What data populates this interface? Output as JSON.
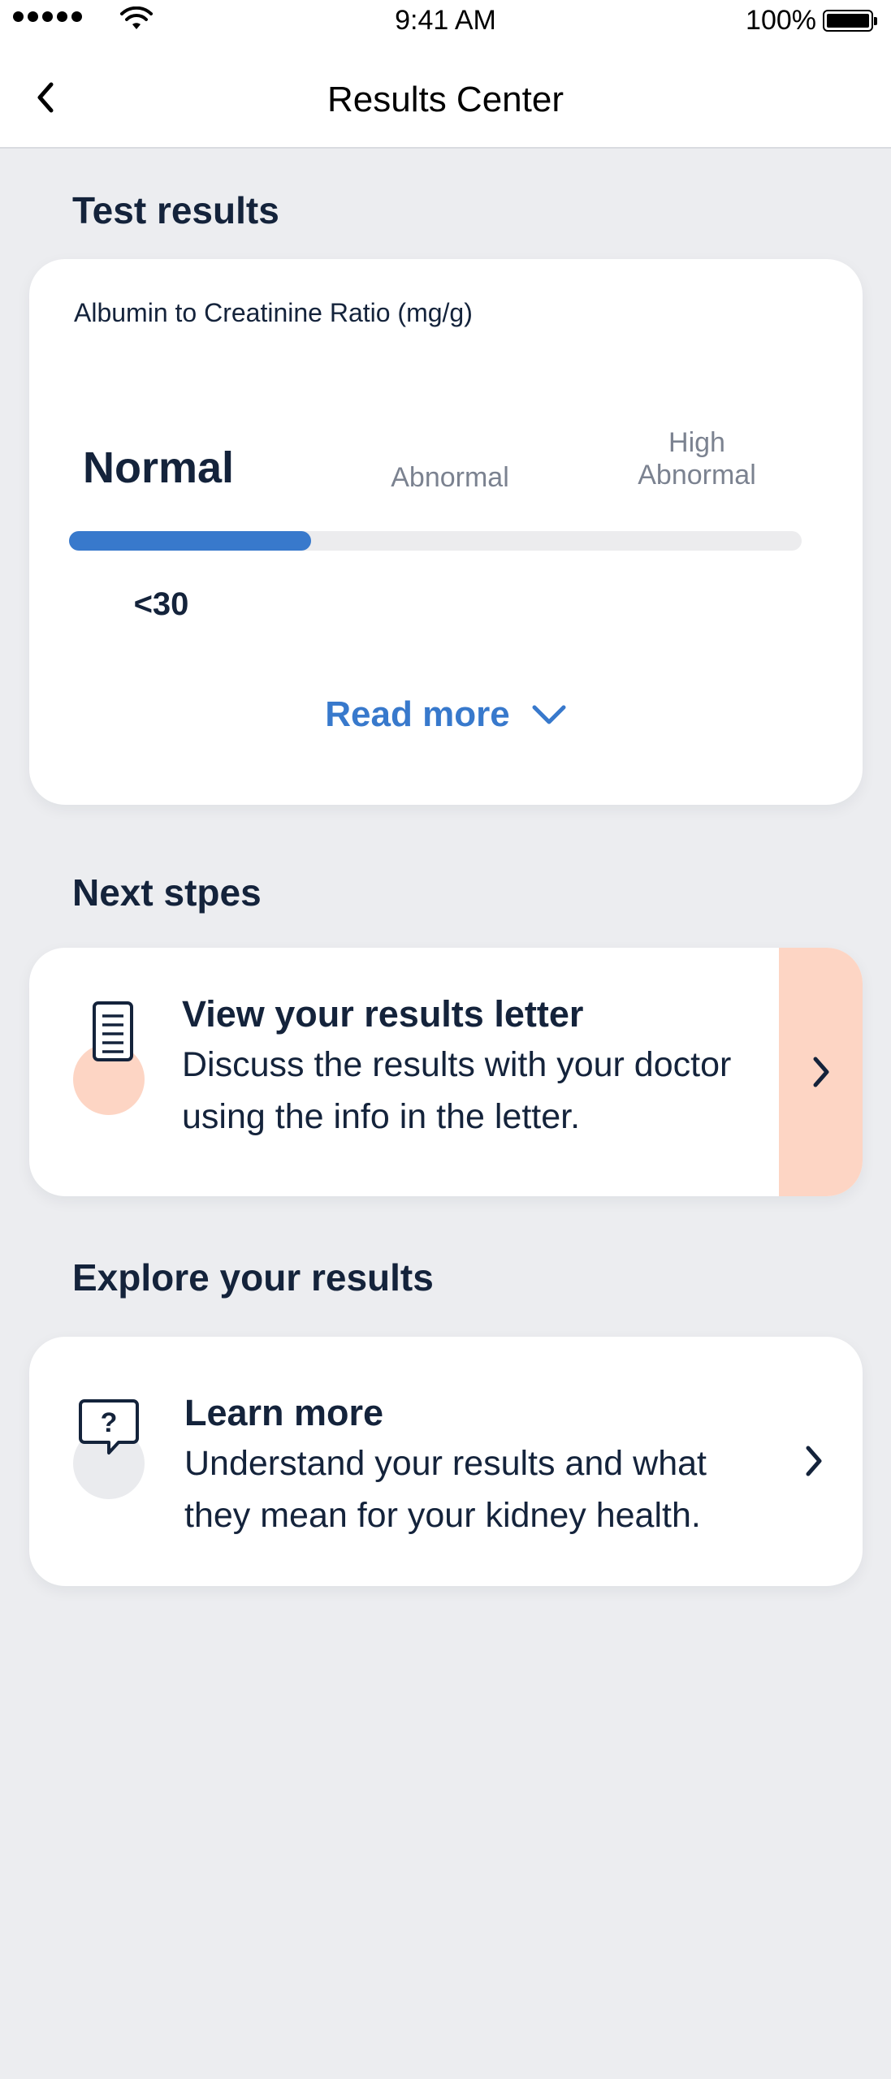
{
  "status_bar": {
    "time": "9:41 AM",
    "battery": "100%"
  },
  "nav": {
    "title": "Results Center"
  },
  "test_results": {
    "heading": "Test results",
    "metric_label": "Albumin to Creatinine Ratio (mg/g)",
    "ranges": {
      "normal": "Normal",
      "abnormal": "Abnormal",
      "high_abnormal": "High\nAbnormal"
    },
    "current_value": "<30",
    "progress_fraction": 0.33,
    "read_more": "Read more"
  },
  "next_steps": {
    "heading": "Next stpes",
    "item": {
      "title": "View your results letter",
      "description": "Discuss the results with your doctor using the info in the letter.",
      "icon": "document-icon"
    }
  },
  "explore": {
    "heading": "Explore your results",
    "item": {
      "title": "Learn more",
      "description": "Understand your results and what they mean for your kidney health.",
      "icon": "question-bubble-icon"
    }
  },
  "colors": {
    "accent": "#3879cc",
    "text": "#14233b",
    "muted": "#7b8290",
    "peach": "#fdd5c4",
    "background": "#ecedf0"
  }
}
